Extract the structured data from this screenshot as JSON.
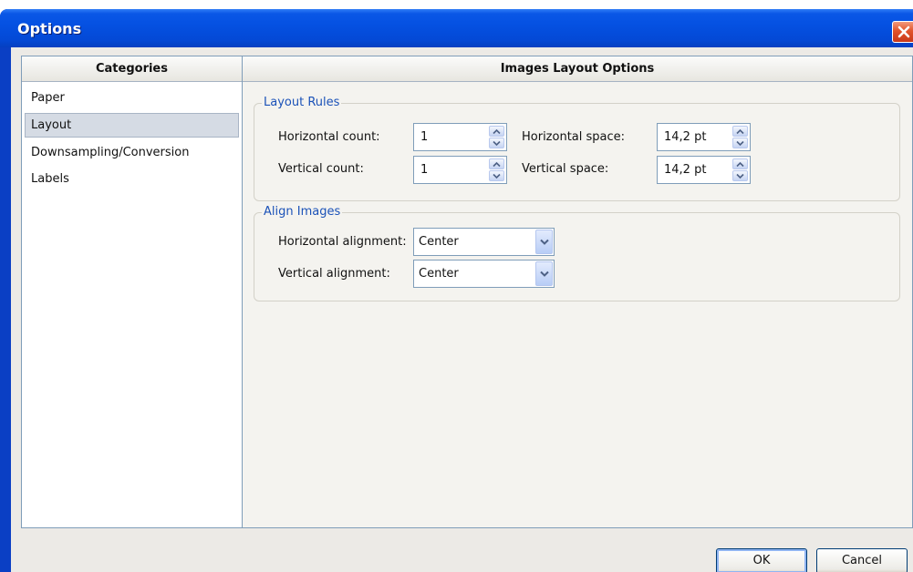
{
  "window": {
    "title": "Options"
  },
  "categories": {
    "header": "Categories",
    "items": [
      {
        "label": "Paper"
      },
      {
        "label": "Layout",
        "selected": true
      },
      {
        "label": "Downsampling/Conversion"
      },
      {
        "label": "Labels"
      }
    ]
  },
  "options": {
    "header": "Images Layout Options",
    "layout_rules": {
      "legend": "Layout Rules",
      "horizontal_count": {
        "label": "Horizontal count:",
        "value": "1"
      },
      "vertical_count": {
        "label": "Vertical count:",
        "value": "1"
      },
      "horizontal_space": {
        "label": "Horizontal space:",
        "value": "14,2 pt"
      },
      "vertical_space": {
        "label": "Vertical space:",
        "value": "14,2 pt"
      }
    },
    "align_images": {
      "legend": "Align Images",
      "horizontal_alignment": {
        "label": "Horizontal alignment:",
        "value": "Center"
      },
      "vertical_alignment": {
        "label": "Vertical alignment:",
        "value": "Center"
      }
    }
  },
  "buttons": {
    "ok": "OK",
    "cancel": "Cancel"
  },
  "icons": {
    "close": "close-icon",
    "spin_up": "chevron-up-icon",
    "spin_down": "chevron-down-icon",
    "dropdown": "chevron-down-icon"
  },
  "colors": {
    "titlebar": "#0551e2",
    "legend_text": "#1b52b8",
    "selection": "#d5dbe4",
    "close_button": "#e2532b"
  }
}
